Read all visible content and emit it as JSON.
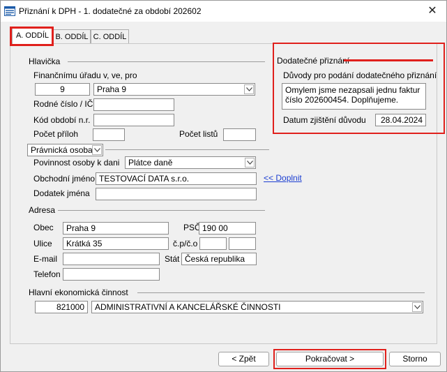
{
  "window": {
    "title": "Přiznání k DPH - 1. dodatečné za období 202602",
    "close_glyph": "✕"
  },
  "tabs": [
    "A. ODDÍL",
    "B. ODDÍL",
    "C. ODDÍL"
  ],
  "hlavicka": {
    "section": "Hlavička",
    "urad_label": "Finančnímu úřadu v, ve, pro",
    "urad_code": "9",
    "urad_name": "Praha 9",
    "rodne_cislo_label": "Rodné číslo / IČ",
    "rodne_cislo": "",
    "kod_obdobi_label": "Kód období n.r.",
    "kod_obdobi": "",
    "pocet_priloh_label": "Počet příloh",
    "pocet_priloh": "",
    "pocet_listu_label": "Počet listů",
    "pocet_listu": ""
  },
  "osoba": {
    "type": "Právnická osoba",
    "povinnost_label": "Povinnost osoby k dani",
    "povinnost": "Plátce daně",
    "obchodni_jmeno_label": "Obchodní jméno",
    "obchodni_jmeno": "TESTOVACÍ DATA s.r.o.",
    "doplnit_link": "<< Doplnit",
    "dodatek_label": "Dodatek jména",
    "dodatek": ""
  },
  "adresa": {
    "section": "Adresa",
    "obec_label": "Obec",
    "obec": "Praha 9",
    "psc_label": "PSČ",
    "psc": "190 00",
    "ulice_label": "Ulice",
    "ulice": "Krátká 35",
    "cp_label": "č.p/č.o",
    "cp": "",
    "co": "",
    "email_label": "E-mail",
    "email": "",
    "stat_label": "Stát",
    "stat": "Česká republika",
    "telefon_label": "Telefon",
    "telefon": ""
  },
  "cinnost": {
    "section": "Hlavní ekonomická činnost",
    "code": "821000",
    "name": "ADMINISTRATIVNÍ A KANCELÁŘSKÉ ČINNOSTI"
  },
  "dodatecne": {
    "section": "Dodatečné přiznání",
    "duvody_label": "Důvody pro podání dodatečného přiznání",
    "duvody": "Omylem jsme nezapsali jednu faktur číslo 202600454. Doplňujeme.",
    "datum_label": "Datum zjištění důvodu",
    "datum": "28.04.2024"
  },
  "buttons": {
    "back": "< Zpět",
    "next": "Pokračovat >",
    "cancel": "Storno"
  },
  "colors": {
    "highlight": "#e0201c",
    "link": "#1a3dd1"
  }
}
